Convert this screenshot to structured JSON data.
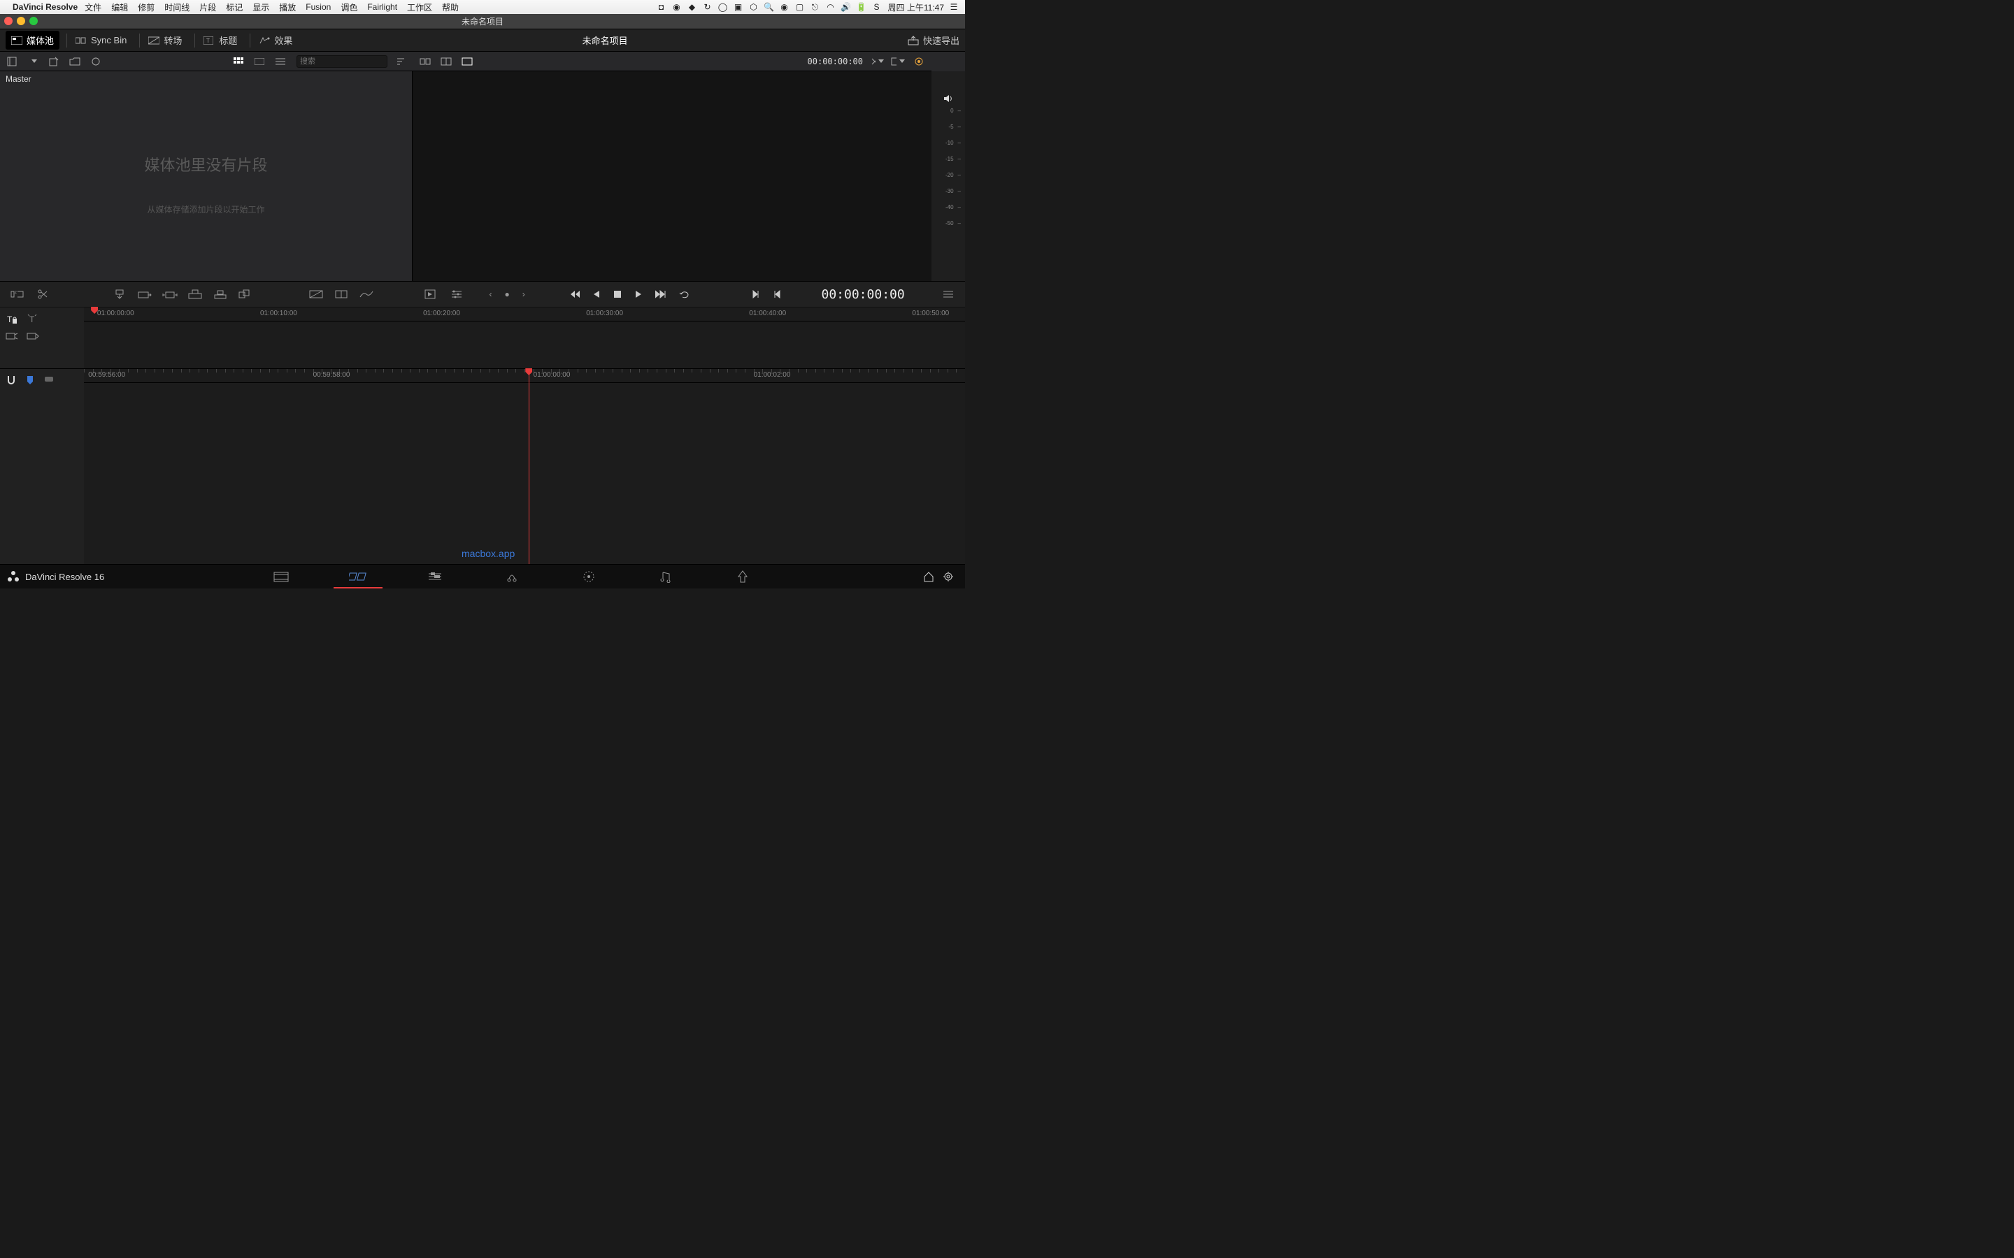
{
  "menubar": {
    "app": "DaVinci Resolve",
    "items": [
      "文件",
      "编辑",
      "修剪",
      "时间线",
      "片段",
      "标记",
      "显示",
      "播放",
      "Fusion",
      "调色",
      "Fairlight",
      "工作区",
      "帮助"
    ],
    "clock": "周四 上午11:47"
  },
  "titlebar": {
    "title": "未命名项目"
  },
  "workspace": {
    "buttons": [
      {
        "label": "媒体池",
        "active": true
      },
      {
        "label": "Sync Bin",
        "active": false
      },
      {
        "label": "转场",
        "active": false
      },
      {
        "label": "标题",
        "active": false
      },
      {
        "label": "效果",
        "active": false
      }
    ],
    "project_title": "未命名项目",
    "quick_export": "快速导出"
  },
  "mediapool": {
    "search_placeholder": "搜索",
    "bin": "Master",
    "empty_title": "媒体池里没有片段",
    "empty_sub": "从媒体存储添加片段以开始工作"
  },
  "viewer": {
    "timecode": "00:00:00:00",
    "vu_labels": [
      "0",
      "-5",
      "-10",
      "-15",
      "-20",
      "-30",
      "-40",
      "-50"
    ]
  },
  "transport": {
    "dots": "• • •",
    "timecode": "00:00:00:00"
  },
  "timeline1": {
    "ticks": [
      "01:00:00:00",
      "01:00:10:00",
      "01:00:20:00",
      "01:00:30:00",
      "01:00:40:00",
      "01:00:50:00"
    ],
    "playhead_pct": 1.2
  },
  "timeline2": {
    "ticks": [
      "00:59:56:00",
      "00:59:58:00",
      "01:00:00:00",
      "01:00:02:00"
    ],
    "playhead_pct": 50.5
  },
  "pagenav": {
    "product": "DaVinci Resolve 16",
    "active_index": 1
  },
  "watermark": "macbox.app"
}
